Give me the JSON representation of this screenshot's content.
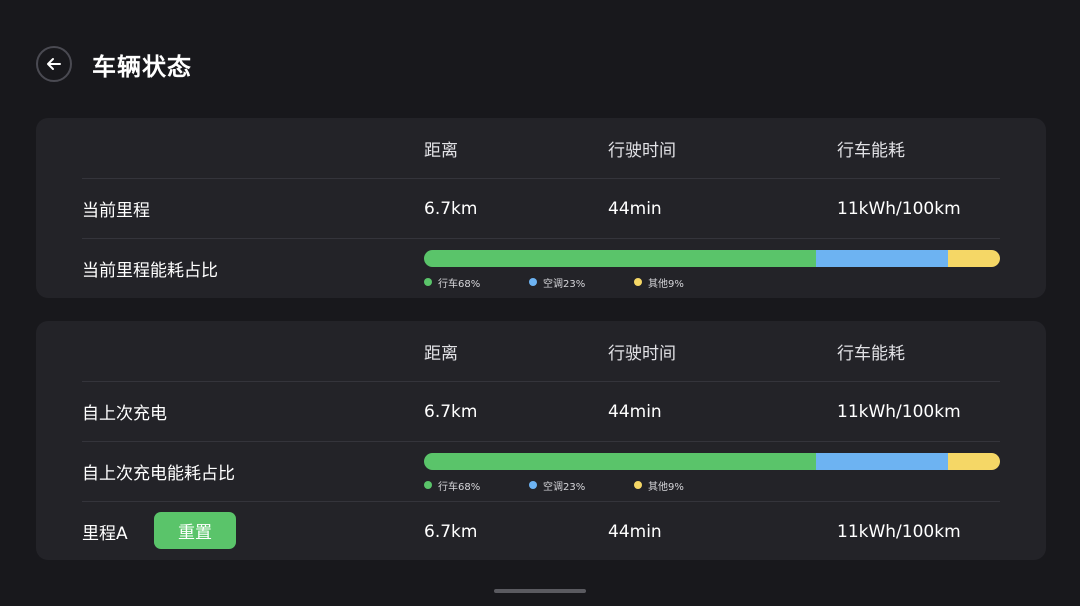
{
  "header": {
    "title": "车辆状态"
  },
  "columns": {
    "distance": "距离",
    "drive_time": "行驶时间",
    "consumption": "行车能耗"
  },
  "colors": {
    "drive": "#5ac46a",
    "ac": "#6db3f2",
    "other": "#f5d766"
  },
  "legend": {
    "drive": "行车68%",
    "ac": "空调23%",
    "other": "其他9%"
  },
  "current_trip": {
    "label": "当前里程",
    "distance": "6.7km",
    "drive_time": "44min",
    "consumption": "11kWh/100km",
    "ratio_label": "当前里程能耗占比",
    "shares": {
      "drive": 68,
      "ac": 23,
      "other": 9
    }
  },
  "since_charge": {
    "label": "自上次充电",
    "distance": "6.7km",
    "drive_time": "44min",
    "consumption": "11kWh/100km",
    "ratio_label": "自上次充电能耗占比",
    "shares": {
      "drive": 68,
      "ac": 23,
      "other": 9
    }
  },
  "trip_a": {
    "label": "里程A",
    "reset_label": "重置",
    "distance": "6.7km",
    "drive_time": "44min",
    "consumption": "11kWh/100km"
  }
}
